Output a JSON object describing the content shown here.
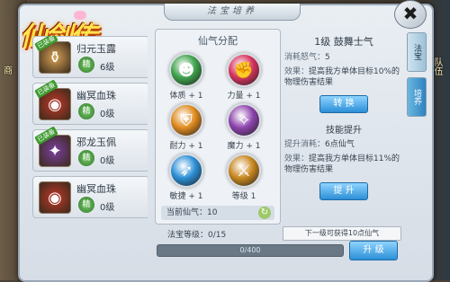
{
  "window": {
    "title": "法宝培养"
  },
  "logo": {
    "text": "仙剑传"
  },
  "bg_chips": {
    "shop": "商",
    "right_top": "队伍"
  },
  "items": [
    {
      "tag": "已装备",
      "name": "归元玉露",
      "level": "6级",
      "icon": "jade-flask-icon",
      "color": "#d9a357"
    },
    {
      "tag": "已装备",
      "name": "幽冥血珠",
      "level": "0级",
      "icon": "blood-orb-icon",
      "color": "#c0392b"
    },
    {
      "tag": "已装备",
      "name": "邪龙玉佩",
      "level": "0级",
      "icon": "dragon-jade-icon",
      "color": "#7b3fa0"
    },
    {
      "tag": "",
      "name": "幽冥血珠",
      "level": "0级",
      "icon": "blood-orb-icon",
      "color": "#c0392b"
    }
  ],
  "item_badge": "精",
  "center": {
    "heading": "仙气分配",
    "stats": [
      {
        "label": "体质 + 1",
        "icon": "body-icon",
        "color": "#3fa34d"
      },
      {
        "label": "力量 + 1",
        "icon": "arm-icon",
        "color": "#d8345f"
      },
      {
        "label": "耐力 + 1",
        "icon": "shield-icon",
        "color": "#e08a1e"
      },
      {
        "label": "魔力 + 1",
        "icon": "magic-icon",
        "color": "#8e44ad"
      },
      {
        "label": "敏捷 + 1",
        "icon": "speed-icon",
        "color": "#2c8fd6"
      },
      {
        "label": "等级 1",
        "icon": "sword-icon",
        "color": "#c9871f"
      }
    ],
    "current_label": "当前仙气：",
    "current_value": "10"
  },
  "right": {
    "skill_title": "1级  鼓舞士气",
    "cost_label": "消耗怒气：",
    "cost_value": "5",
    "effect_label": "效果：",
    "effect_text": "提高我方单体目标10%的物理伤害结果",
    "convert_button": "转  换",
    "upgrade_header": "技能提升",
    "up_cost_label": "提升消耗：",
    "up_cost_value": "6点仙气",
    "up_effect_label": "效果：",
    "up_effect_text": "提高我方单体目标11%的物理伤害结果",
    "raise_button": "提  升"
  },
  "tabs": [
    "法宝",
    "培养"
  ],
  "footer": {
    "level_label": "法宝等级：",
    "level_value": "0/15",
    "next_text": "下一级可获得10点仙气",
    "progress_text": "0/400",
    "progress": 0.0,
    "upgrade_button": "升  级"
  },
  "colors": {
    "accent": "#2c8fd6",
    "panel": "#e9eef3"
  }
}
